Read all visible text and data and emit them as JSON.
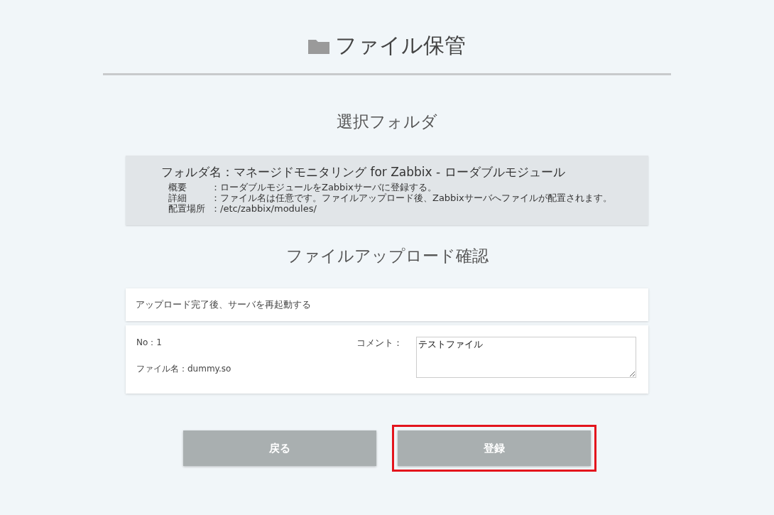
{
  "page_title": "ファイル保管",
  "selected_folder": {
    "heading": "選択フォルダ",
    "folder_name": "フォルダ名：マネージドモニタリング for Zabbix - ローダブルモジュール",
    "details": [
      {
        "label": "概要",
        "value": "：ローダブルモジュールをZabbixサーバに登録する。"
      },
      {
        "label": "詳細",
        "value": "：ファイル名は任意です。ファイルアップロード後、Zabbixサーバへファイルが配置されます。"
      },
      {
        "label": "配置場所",
        "value": "：/etc/zabbix/modules/"
      }
    ]
  },
  "upload": {
    "heading": "ファイルアップロード確認",
    "notice": "アップロード完了後、サーバを再起動する",
    "files": [
      {
        "number": "No：1",
        "file_name": "ファイル名：dummy.so",
        "comment_label": "コメント：",
        "comment": "テストファイル"
      }
    ]
  },
  "buttons": [
    {
      "label": "戻る",
      "highlighted": false
    },
    {
      "label": "登録",
      "highlighted": true
    }
  ]
}
